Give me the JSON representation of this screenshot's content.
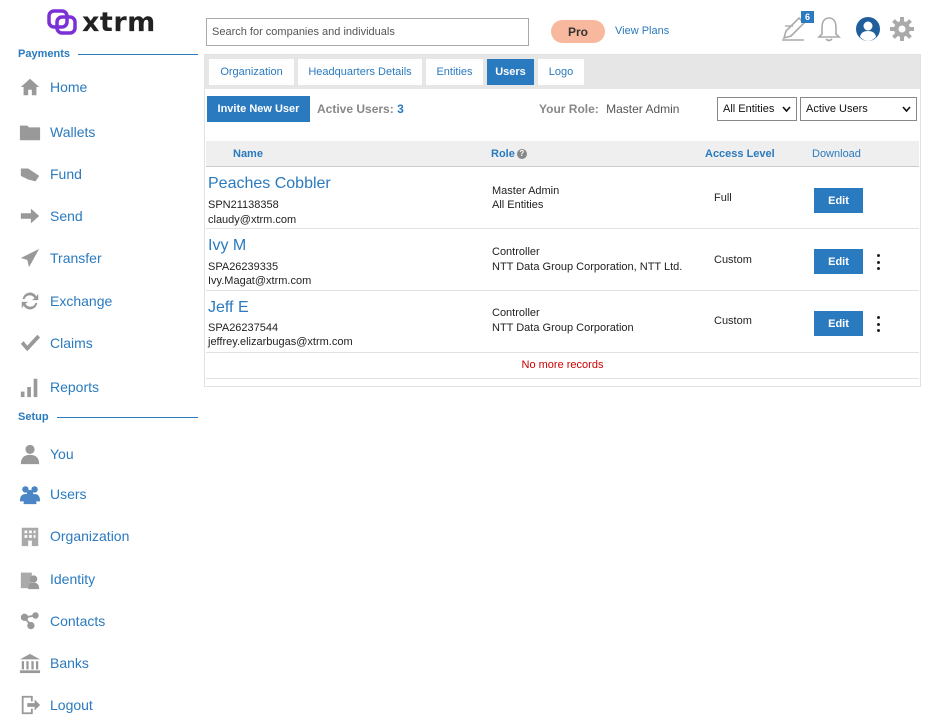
{
  "brand": {
    "name": "xtrm",
    "color": "#7b2fd6"
  },
  "sidebar": {
    "payments_heading": "Payments",
    "setup_heading": "Setup",
    "payments": [
      {
        "label": "Home",
        "icon": "home-icon"
      },
      {
        "label": "Wallets",
        "icon": "folder-icon"
      },
      {
        "label": "Fund",
        "icon": "hand-money-icon"
      },
      {
        "label": "Send",
        "icon": "arrow-right-icon"
      },
      {
        "label": "Transfer",
        "icon": "paper-plane-icon"
      },
      {
        "label": "Exchange",
        "icon": "exchange-icon"
      },
      {
        "label": "Claims",
        "icon": "checkmark-icon"
      },
      {
        "label": "Reports",
        "icon": "bar-chart-icon"
      }
    ],
    "setup": [
      {
        "label": "You",
        "icon": "person-icon"
      },
      {
        "label": "Users",
        "icon": "users-icon"
      },
      {
        "label": "Organization",
        "icon": "building-icon"
      },
      {
        "label": "Identity",
        "icon": "identity-icon"
      },
      {
        "label": "Contacts",
        "icon": "contacts-icon"
      },
      {
        "label": "Banks",
        "icon": "bank-icon"
      },
      {
        "label": "Logout",
        "icon": "logout-icon"
      }
    ]
  },
  "header": {
    "search_placeholder": "Search for companies and individuals",
    "plan_badge": "Pro",
    "view_plans": "View Plans",
    "notification_count": "6"
  },
  "tabs": [
    {
      "label": "Organization",
      "active": false
    },
    {
      "label": "Headquarters Details",
      "active": false
    },
    {
      "label": "Entities",
      "active": false
    },
    {
      "label": "Users",
      "active": true
    },
    {
      "label": "Logo",
      "active": false
    }
  ],
  "toolbar": {
    "invite_label": "Invite New User",
    "active_users_label": "Active Users:",
    "active_users_count": "3",
    "your_role_label": "Your Role:",
    "your_role_value": "Master Admin",
    "entity_filter": "All Entities",
    "status_filter": "Active Users"
  },
  "table": {
    "columns": {
      "name": "Name",
      "role": "Role",
      "access": "Access Level",
      "download": "Download"
    },
    "rows": [
      {
        "name": "Peaches Cobbler",
        "id": "SPN21138358",
        "email": "claudy@xtrm.com",
        "role": "Master Admin",
        "scope": "All Entities",
        "access": "Full",
        "edit": "Edit",
        "has_menu": false
      },
      {
        "name": "Ivy M",
        "id": "SPA26239335",
        "email": "Ivy.Magat@xtrm.com",
        "role": "Controller",
        "scope": "NTT Data Group Corporation, NTT Ltd.",
        "access": "Custom",
        "edit": "Edit",
        "has_menu": true
      },
      {
        "name": "Jeff E",
        "id": "SPA26237544",
        "email": "jeffrey.elizarbugas@xtrm.com",
        "role": "Controller",
        "scope": "NTT Data Group Corporation",
        "access": "Custom",
        "edit": "Edit",
        "has_menu": true
      }
    ],
    "footer": "No more records"
  },
  "colors": {
    "accent": "#2a7abf",
    "pro": "#f7b89d",
    "error": "#cc0000"
  }
}
